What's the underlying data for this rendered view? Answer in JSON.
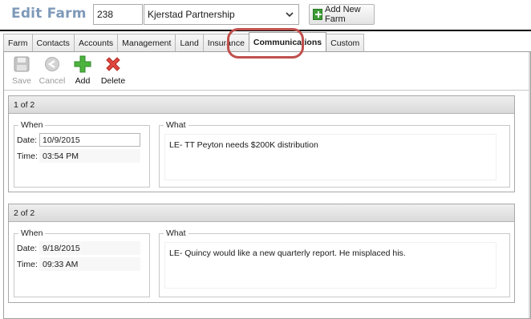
{
  "header": {
    "title": "Edit Farm",
    "farm_id": "238",
    "farm_name": "Kjerstad Partnership",
    "add_new_farm_label": "Add New Farm"
  },
  "tabs": [
    {
      "label": "Farm",
      "active": false
    },
    {
      "label": "Contacts",
      "active": false
    },
    {
      "label": "Accounts",
      "active": false
    },
    {
      "label": "Management",
      "active": false
    },
    {
      "label": "Land",
      "active": false
    },
    {
      "label": "Insurance",
      "active": false
    },
    {
      "label": "Communications",
      "active": true
    },
    {
      "label": "Custom",
      "active": false
    }
  ],
  "toolbar": {
    "save_label": "Save",
    "cancel_label": "Cancel",
    "add_label": "Add",
    "delete_label": "Delete"
  },
  "records": [
    {
      "header": "1 of 2",
      "when_label": "When",
      "what_label": "What",
      "date_label": "Date:",
      "date": "10/9/2015",
      "time_label": "Time:",
      "time": "03:54 PM",
      "what": "LE-  TT Peyton needs $200K distribution"
    },
    {
      "header": "2 of 2",
      "when_label": "When",
      "what_label": "What",
      "date_label": "Date:",
      "date": "9/18/2015",
      "time_label": "Time:",
      "time": "09:33 AM",
      "what": "LE- Quincy would like a new quarterly report.  He misplaced his."
    }
  ],
  "colors": {
    "title": "#7f9ab9",
    "highlight": "#c0504d",
    "add_green": "#3d9b35",
    "delete_red": "#d9433b"
  }
}
